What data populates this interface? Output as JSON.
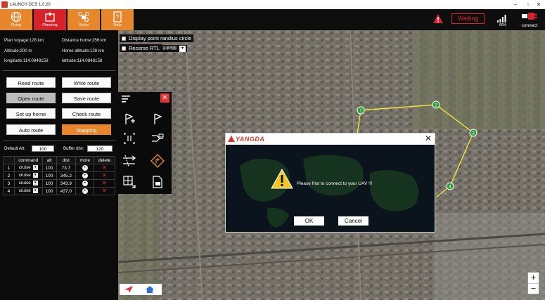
{
  "window": {
    "title": "LAUNCH GCS 1.0.20",
    "controls": [
      "–",
      "▫",
      "✕"
    ]
  },
  "toolbar": {
    "tabs": [
      {
        "label": "Flying",
        "icon": "globe-icon"
      },
      {
        "label": "Planning",
        "icon": "map-pin-icon"
      },
      {
        "label": "Setup",
        "icon": "drone-gear-icon"
      },
      {
        "label": "Help",
        "icon": "help-doc-icon"
      }
    ],
    "status": "Waiting",
    "signal_value": "80%",
    "connect_label": "connect"
  },
  "info": {
    "plan_voyage": "Plan voyage:128 km",
    "distance_home": "Distance home:256 km",
    "altitude": "Altitude:200 m",
    "home_altitude": "Home altitude:128 km",
    "longitude": "longitude:114.0848158",
    "latitude": "latitude:114.0848158"
  },
  "route_buttons": {
    "read": "Read route",
    "write": "Write route",
    "open": "Open route",
    "save": "Save route",
    "setup_home": "Set up home",
    "check": "Check route",
    "auto": "Auto route",
    "mapping": "Mapping"
  },
  "fields": {
    "default_alt_label": "Default Alt:",
    "default_alt_value": "100",
    "buffer_dist_label": "Buffer dist:",
    "buffer_dist_value": "120"
  },
  "table": {
    "headers": [
      "",
      "command",
      "alt",
      "dist",
      "more",
      "delete"
    ],
    "rows": [
      {
        "n": "1",
        "command": "cruise",
        "alt": "100",
        "dist": "73.7"
      },
      {
        "n": "2",
        "command": "cruise",
        "alt": "100",
        "dist": "345.2"
      },
      {
        "n": "3",
        "command": "cruise",
        "alt": "100",
        "dist": "343.9"
      },
      {
        "n": "4",
        "command": "cruise",
        "alt": "100",
        "dist": "437.0"
      }
    ]
  },
  "map": {
    "display_radius_label": "Display point randius circle",
    "reverse_rtl_label": "Recerse RTL",
    "lang_select": "谷歌地图",
    "waypoints": [
      "1",
      "2",
      "3",
      "4"
    ],
    "zoom_in": "+",
    "zoom_out": "−"
  },
  "dialog": {
    "brand": "YANGDA",
    "close": "✕",
    "message": "Please frist to connect to your UAV !!!",
    "ok": "OK",
    "cancel": "Cancel"
  },
  "colors": {
    "accent": "#e8862c",
    "danger": "#d6232a",
    "route_line": "#f2e33a",
    "waypoint": "#2e9a3a"
  }
}
